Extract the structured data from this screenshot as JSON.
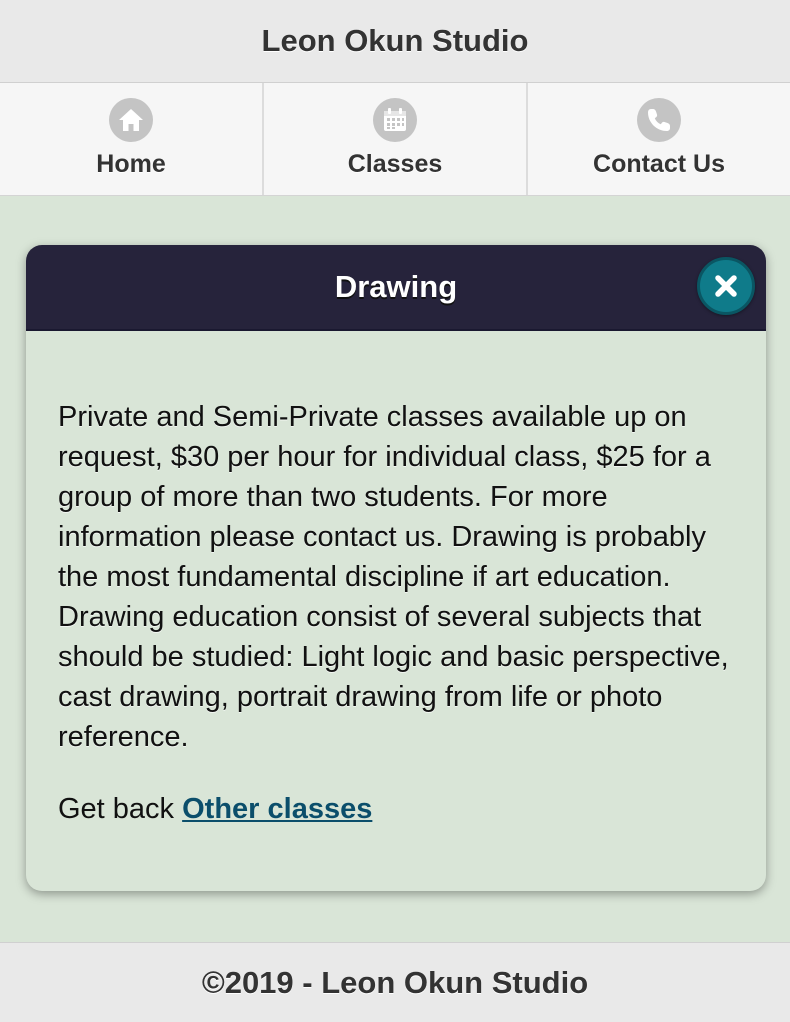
{
  "header": {
    "title": "Leon Okun Studio"
  },
  "nav": {
    "items": [
      {
        "label": "Home",
        "icon": "home-icon"
      },
      {
        "label": "Classes",
        "icon": "calendar-icon"
      },
      {
        "label": "Contact Us",
        "icon": "phone-icon"
      }
    ]
  },
  "dialog": {
    "title": "Drawing",
    "close_icon": "close-icon",
    "body": "Private and Semi-Private classes available up on request, $30 per hour for individual class, $25 for a group of more than two students. For more information please contact us. Drawing is probably the most fundamental discipline if art education. Drawing education consist of several subjects that should be studied: Light logic and basic perspective, cast drawing, portrait drawing from life or photo reference.",
    "back_prefix": "Get back",
    "back_link": "Other classes"
  },
  "footer": {
    "text": "©2019 - Leon Okun Studio"
  },
  "colors": {
    "background": "#d9e5d7",
    "dialog_header": "#26233b",
    "close_button": "#0f7b8a",
    "link": "#0b4e6b"
  }
}
